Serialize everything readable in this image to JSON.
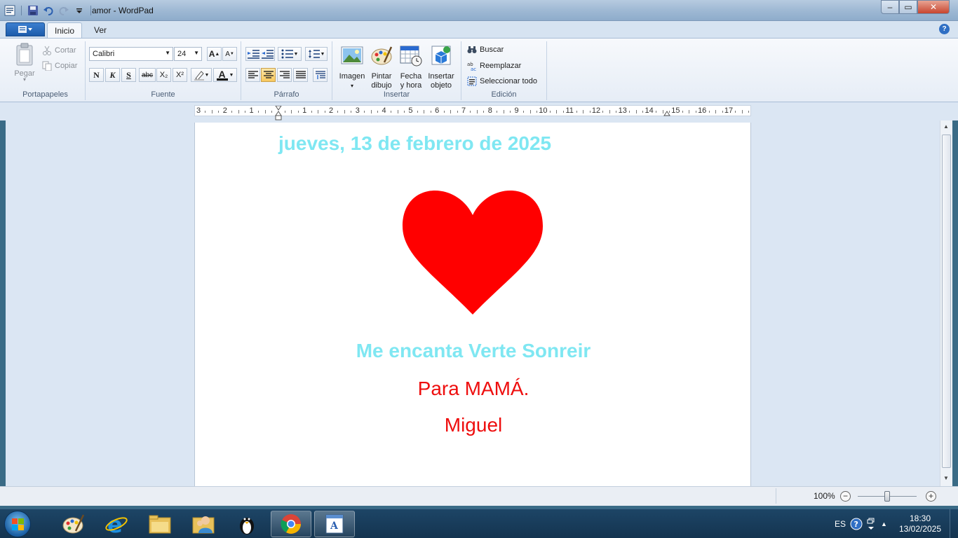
{
  "window": {
    "title": "amor - WordPad",
    "controls": {
      "minimize": "–",
      "maximize": "▭",
      "close": "✕"
    }
  },
  "ribbon": {
    "tabs": [
      "Inicio",
      "Ver"
    ],
    "help_icon": "?",
    "clipboard": {
      "label": "Portapapeles",
      "paste": "Pegar",
      "cut": "Cortar",
      "copy": "Copiar"
    },
    "font": {
      "label": "Fuente",
      "family": "Calibri",
      "size": "24",
      "grow": "A",
      "shrink": "A",
      "bold": "N",
      "italic": "K",
      "underline": "S",
      "strikethrough": "abc",
      "subscript": "X₂",
      "superscript": "X²",
      "color_letter": "A"
    },
    "paragraph": {
      "label": "Párrafo"
    },
    "insert": {
      "label": "Insertar",
      "image": "Imagen",
      "paint_l1": "Pintar",
      "paint_l2": "dibujo",
      "date_l1": "Fecha",
      "date_l2": "y hora",
      "object_l1": "Insertar",
      "object_l2": "objeto"
    },
    "editing": {
      "label": "Edición",
      "find": "Buscar",
      "replace": "Reemplazar",
      "select_all": "Seleccionar todo"
    }
  },
  "ruler": {
    "labels": [
      "3",
      "2",
      "1",
      "",
      "1",
      "2",
      "3",
      "4",
      "5",
      "6",
      "7",
      "8",
      "9",
      "10",
      "11",
      "12",
      "13",
      "14",
      "15",
      "16",
      "17"
    ]
  },
  "document": {
    "date": "jueves, 13 de febrero de 2025",
    "line1": "Me encanta Verte Sonreir",
    "line2": "Para MAMÁ.",
    "line3": "Miguel",
    "colors": {
      "cyan_text": "#7fe7f2",
      "red_text": "#ee0e0e",
      "heart": "#ff0000"
    }
  },
  "status": {
    "zoom": "100%",
    "zoom_out": "−",
    "zoom_in": "+"
  },
  "taskbar": {
    "apps": [
      "paint-icon",
      "internet-explorer-icon",
      "file-explorer-icon",
      "users-icon",
      "penguin-icon",
      "chrome-icon",
      "wordpad-icon"
    ],
    "language": "ES",
    "time": "18:30",
    "date": "13/02/2025"
  },
  "colors": {
    "ribbon_bg": "#e6edf6",
    "titlebar": "#9fb9d4",
    "taskbar": "#1d4566",
    "accent": "#2f6fc4"
  }
}
